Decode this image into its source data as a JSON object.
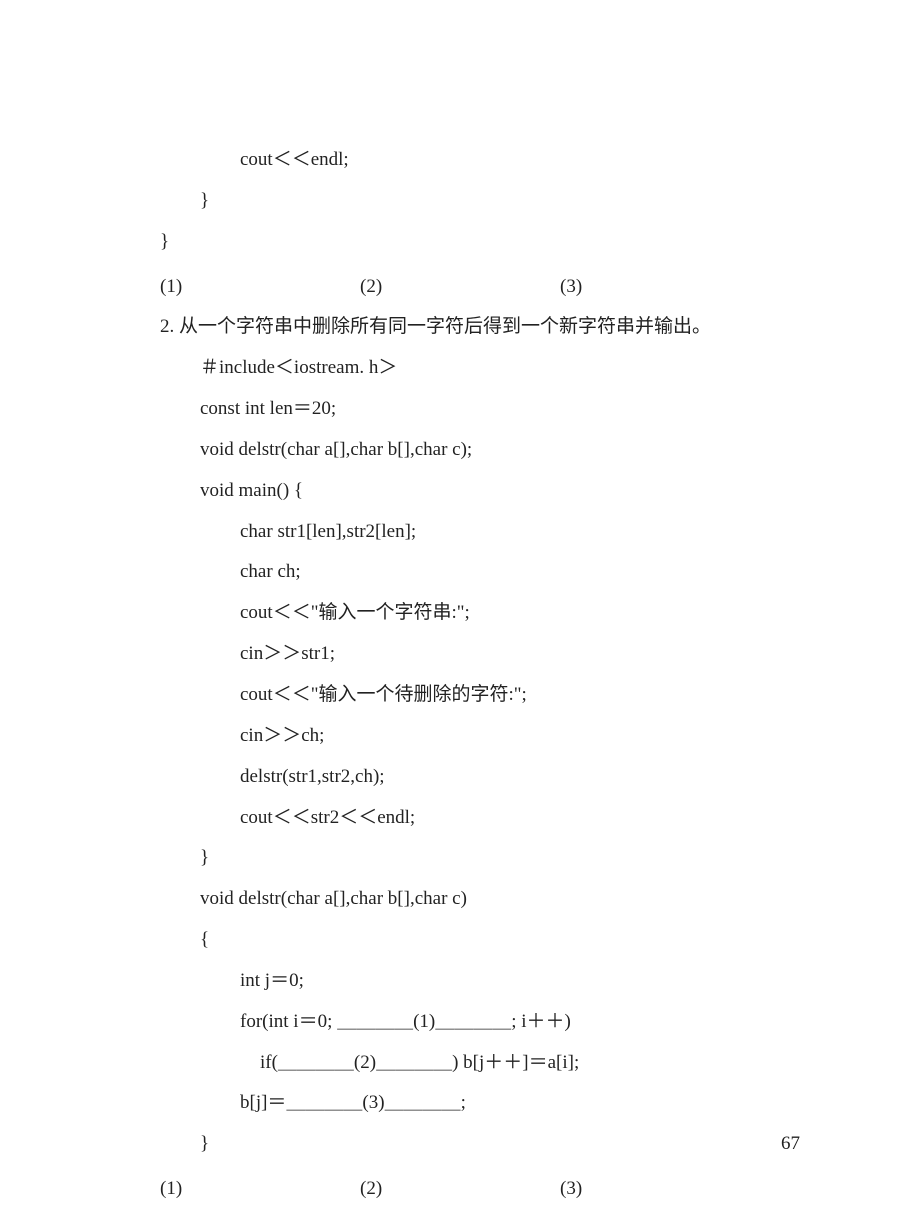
{
  "lines": {
    "l1": "cout＜＜endl;",
    "l2": "}",
    "l3": "}",
    "ans1_1": "(1)",
    "ans1_2": "(2)",
    "ans1_3": "(3)",
    "q2": "2. 从一个字符串中删除所有同一字符后得到一个新字符串并输出。",
    "inc": "＃include＜iostream. h＞",
    "constline": "const int len＝20;",
    "proto": "void delstr(char a[],char b[],char c);",
    "mainopen": "void main() {",
    "m1": "char str1[len],str2[len];",
    "m2": "char ch;",
    "m3": "cout＜＜\"输入一个字符串:\";",
    "m4": "cin＞＞str1;",
    "m5": "cout＜＜\"输入一个待删除的字符:\";",
    "m6": "cin＞＞ch;",
    "m7": "delstr(str1,str2,ch);",
    "m8": "cout＜＜str2＜＜endl;",
    "mainclose": "}",
    "defline": "void delstr(char a[],char b[],char c)",
    "openbrace": "{",
    "d1": "int j＝0;",
    "d2": "for(int i＝0; ＿＿＿＿(1)＿＿＿＿; i＋＋)",
    "d3": "if(＿＿＿＿(2)＿＿＿＿) b[j＋＋]＝a[i];",
    "d4": "b[j]＝＿＿＿＿(3)＿＿＿＿;",
    "closebrace": "}",
    "ans2_1": "(1)",
    "ans2_2": "(2)",
    "ans2_3": "(3)"
  },
  "page_number": "67"
}
